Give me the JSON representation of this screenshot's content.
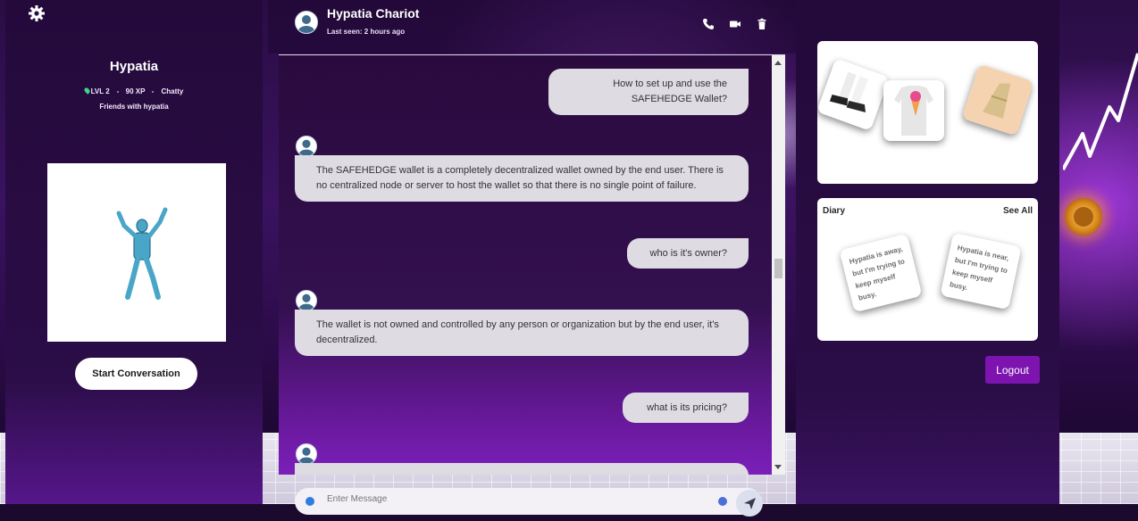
{
  "profile": {
    "name": "Hypatia",
    "level": "LVL 2",
    "xp": "90 XP",
    "mood": "Chatty",
    "friendship": "Friends with hypatia",
    "start_button": "Start Conversation"
  },
  "chat": {
    "contact_name": "Hypatia Chariot",
    "last_seen": "Last seen: 2 hours ago",
    "messages": [
      {
        "from": "user",
        "text": "How to set up and use the SAFEHEDGE Wallet?"
      },
      {
        "from": "bot",
        "text": "The SAFEHEDGE wallet is a completely decentralized wallet owned by the end user. There is no centralized node or server to host the wallet so that there is no single point of failure."
      },
      {
        "from": "user",
        "text": "who is it's owner?"
      },
      {
        "from": "bot",
        "text": "The wallet is not owned and controlled by any person or organization but by the end user, it's decentralized."
      },
      {
        "from": "user",
        "text": "what is its pricing?"
      }
    ],
    "composer_placeholder": "Enter Message"
  },
  "diary": {
    "title": "Diary",
    "see_all": "See All",
    "notes": [
      "Hypatia is away, but I'm trying to keep myself busy.",
      "Hypatia is near, but I'm trying to keep myself busy."
    ]
  },
  "logout_label": "Logout",
  "colors": {
    "accent": "#7d14b0",
    "panel": "#2b0d47",
    "bubble": "#dedbe2",
    "status_online": "#3dd68c"
  },
  "icons": {
    "settings": "gear-icon",
    "call": "phone-icon",
    "video": "video-icon",
    "delete": "trash-icon",
    "attach": "plus-icon",
    "emoji": "emoji-icon",
    "send": "send-icon"
  }
}
